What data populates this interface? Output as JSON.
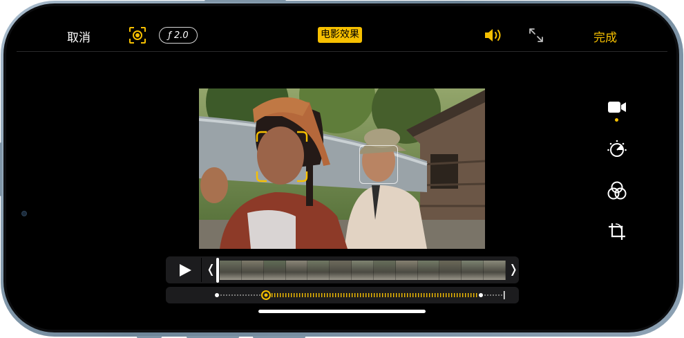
{
  "topbar": {
    "cancel_label": "取消",
    "aperture_label": "ƒ 2.0",
    "cinematic_label": "电影效果",
    "done_label": "完成"
  },
  "icons": {
    "focus": "focus-lock-icon",
    "volume": "speaker-volume-icon",
    "fullscreen": "expand-arrows-icon",
    "video": "video-camera-icon",
    "adjust": "adjust-dial-icon",
    "filters": "filters-circles-icon",
    "crop": "crop-rotate-icon",
    "play": "play-icon"
  },
  "timeline": {
    "trim_left_glyph": "❬",
    "trim_right_glyph": "❭",
    "frame_count": 13
  },
  "colors": {
    "accent": "#f7c000",
    "background": "#000000",
    "panel": "#1c1c1e"
  }
}
